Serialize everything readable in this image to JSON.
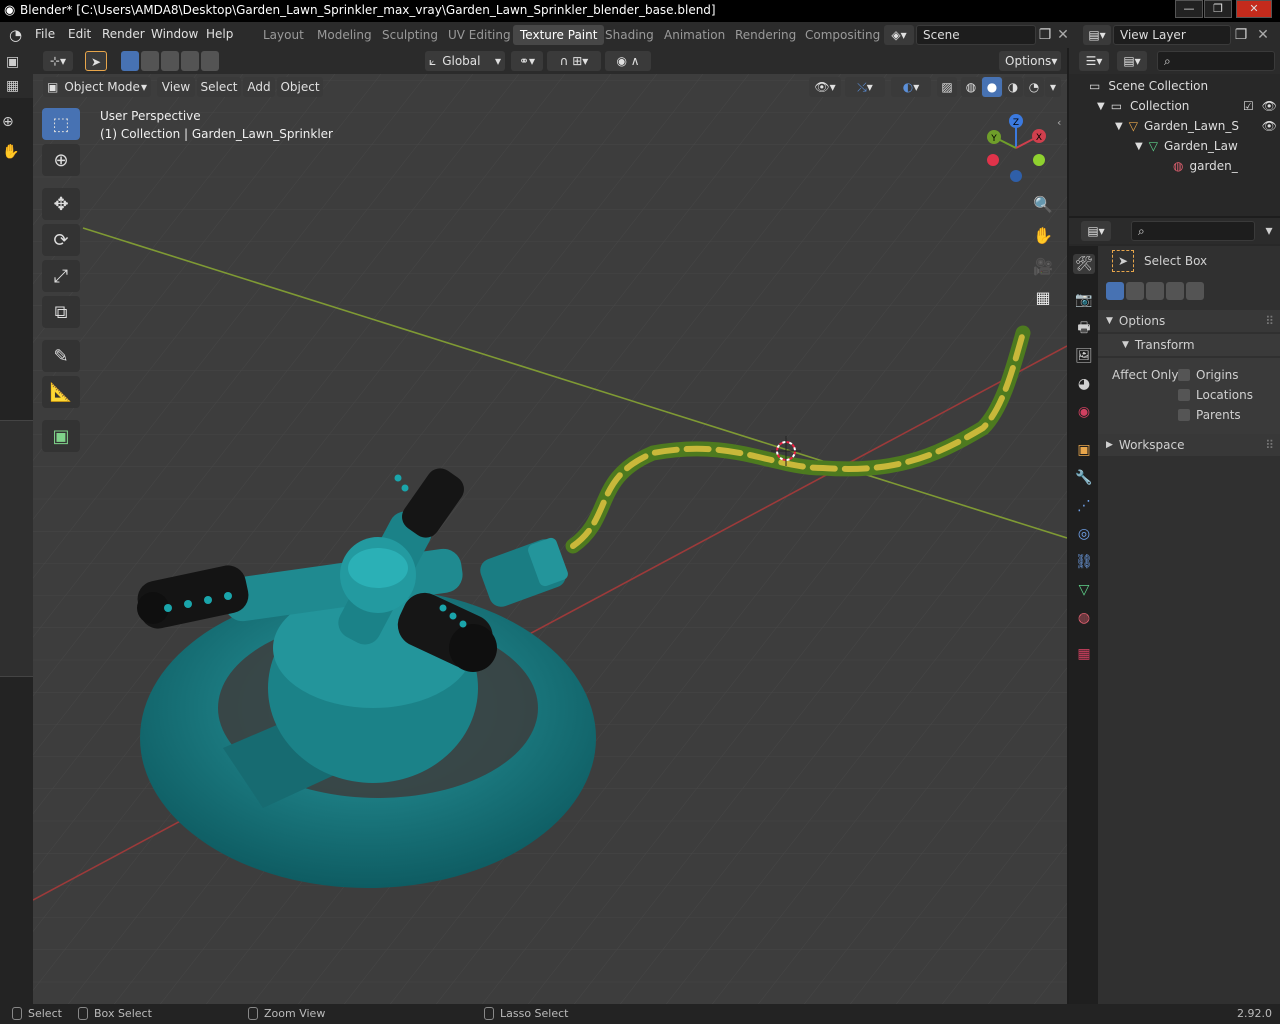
{
  "window": {
    "title": "Blender* [C:\\Users\\AMDA8\\Desktop\\Garden_Lawn_Sprinkler_max_vray\\Garden_Lawn_Sprinkler_blender_base.blend]",
    "minimize": "—",
    "maximize": "❐",
    "close": "✕"
  },
  "menu": {
    "file": "File",
    "edit": "Edit",
    "render": "Render",
    "window": "Window",
    "help": "Help"
  },
  "workspaces": [
    "Layout",
    "Modeling",
    "Sculpting",
    "UV Editing",
    "Texture Paint",
    "Shading",
    "Animation",
    "Rendering",
    "Compositing"
  ],
  "active_workspace": "Texture Paint",
  "scene": {
    "name": "Scene",
    "view_layer": "View Layer"
  },
  "viewport": {
    "transform_orientation": "Global",
    "options_label": "Options",
    "mode": "Object Mode",
    "header_menus": {
      "view": "View",
      "select": "Select",
      "add": "Add",
      "object": "Object"
    },
    "overlay_title": "User Perspective",
    "overlay_subtitle": "(1) Collection | Garden_Lawn_Sprinkler",
    "gizmo": {
      "x": "X",
      "y": "Y",
      "z": "Z"
    }
  },
  "outliner": {
    "rows": [
      {
        "label": "Scene Collection"
      },
      {
        "label": "Collection"
      },
      {
        "label": "Garden_Lawn_S"
      },
      {
        "label": "Garden_Law"
      },
      {
        "label": "garden_"
      }
    ]
  },
  "properties": {
    "tool_name": "Select Box",
    "options_label": "Options",
    "transform_label": "Transform",
    "affect_only_label": "Affect Only",
    "origins": "Origins",
    "locations": "Locations",
    "parents": "Parents",
    "workspace_label": "Workspace"
  },
  "statusbar": {
    "select": "Select",
    "box_select": "Box Select",
    "zoom_view": "Zoom View",
    "lasso_select": "Lasso Select",
    "version": "2.92.0"
  },
  "colors": {
    "accent": "#4772b3",
    "sprinkler": "#1b7f86",
    "hose_green": "#6aa329",
    "hose_yellow": "#c9b83a",
    "x_axis": "#a33b3b",
    "y_axis": "#6c8a2a"
  }
}
